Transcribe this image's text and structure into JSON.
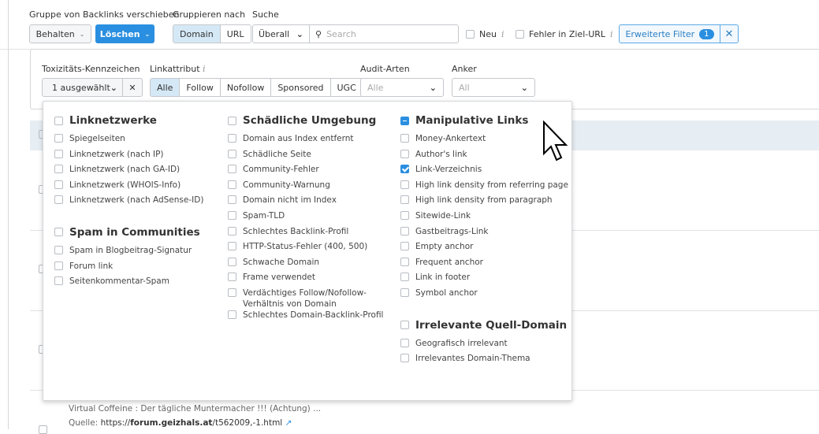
{
  "toolbar": {
    "move_group_label": "Gruppe von Backlinks verschieben",
    "keep_button": "Behalten",
    "delete_button": "Löschen",
    "group_by_label": "Gruppieren nach",
    "group_by_options": [
      "Domain",
      "URL"
    ],
    "group_by_selected": "Domain",
    "search_label": "Suche",
    "search_scope": "Überall",
    "search_placeholder": "Search",
    "new_label": "Neu",
    "target_error_label": "Fehler in Ziel-URL",
    "advanced_filter_label": "Erweiterte Filter",
    "advanced_filter_count": "1",
    "accent": "#2a8fe0"
  },
  "filters": {
    "toxicity_label": "Toxizitäts-Kennzeichen",
    "toxicity_value": "1 ausgewählt",
    "linkattr_label": "Linkattribut",
    "linkattr_options": [
      "Alle",
      "Follow",
      "Nofollow",
      "Sponsored",
      "UGC"
    ],
    "linkattr_selected": "Alle",
    "audit_label": "Audit-Arten",
    "audit_value": "Alle",
    "anchor_label": "Anker",
    "anchor_value": "All"
  },
  "dropdown": {
    "columns": [
      [
        {
          "title": "Linknetzwerke",
          "state": "off",
          "items": [
            {
              "label": "Spiegelseiten"
            },
            {
              "label": "Linknetzwerk (nach IP)"
            },
            {
              "label": "Linknetzwerk (nach GA-ID)"
            },
            {
              "label": "Linknetzwerk (WHOIS-Info)"
            },
            {
              "label": "Linknetzwerk (nach AdSense-ID)"
            }
          ]
        },
        {
          "title": "Spam in Communities",
          "state": "off",
          "items": [
            {
              "label": "Spam in Blogbeitrag-Signatur"
            },
            {
              "label": "Forum link"
            },
            {
              "label": "Seitenkommentar-Spam"
            }
          ]
        }
      ],
      [
        {
          "title": "Schädliche Umgebung",
          "state": "off",
          "items": [
            {
              "label": "Domain aus Index entfernt"
            },
            {
              "label": "Schädliche Seite"
            },
            {
              "label": "Community-Fehler"
            },
            {
              "label": "Community-Warnung"
            },
            {
              "label": "Domain nicht im Index"
            },
            {
              "label": "Spam-TLD"
            },
            {
              "label": "Schlechtes Backlink-Profil"
            },
            {
              "label": "HTTP-Status-Fehler (400, 500)"
            },
            {
              "label": "Schwache Domain"
            },
            {
              "label": "Frame verwendet"
            },
            {
              "label": "Verdächtiges Follow/Nofollow-Verhältnis von Domain"
            },
            {
              "label": "Schlechtes Domain-Backlink-Profil"
            }
          ]
        }
      ],
      [
        {
          "title": "Manipulative Links",
          "state": "ind",
          "items": [
            {
              "label": "Money-Ankertext"
            },
            {
              "label": "Author's link"
            },
            {
              "label": "Link-Verzeichnis",
              "checked": true
            },
            {
              "label": "High link density from referring page"
            },
            {
              "label": "High link density from paragraph"
            },
            {
              "label": "Sitewide-Link"
            },
            {
              "label": "Gastbeitrags-Link"
            },
            {
              "label": "Empty anchor"
            },
            {
              "label": "Frequent anchor"
            },
            {
              "label": "Link in footer"
            },
            {
              "label": "Symbol anchor"
            }
          ]
        },
        {
          "title": "Irrelevante Quell-Domain",
          "state": "off",
          "items": [
            {
              "label": "Geografisch irrelevant"
            },
            {
              "label": "Irrelevantes Domain-Thema"
            }
          ]
        }
      ]
    ]
  },
  "table": {
    "last_row_title": "Virtual Coffeine : Der tägliche Muntermacher !!! (Achtung) ...",
    "source_label": "Quelle:",
    "source_url_prefix": "https://",
    "source_url_domain": "forum.geizhals.at",
    "source_url_path": "/t562009,-1.html"
  }
}
